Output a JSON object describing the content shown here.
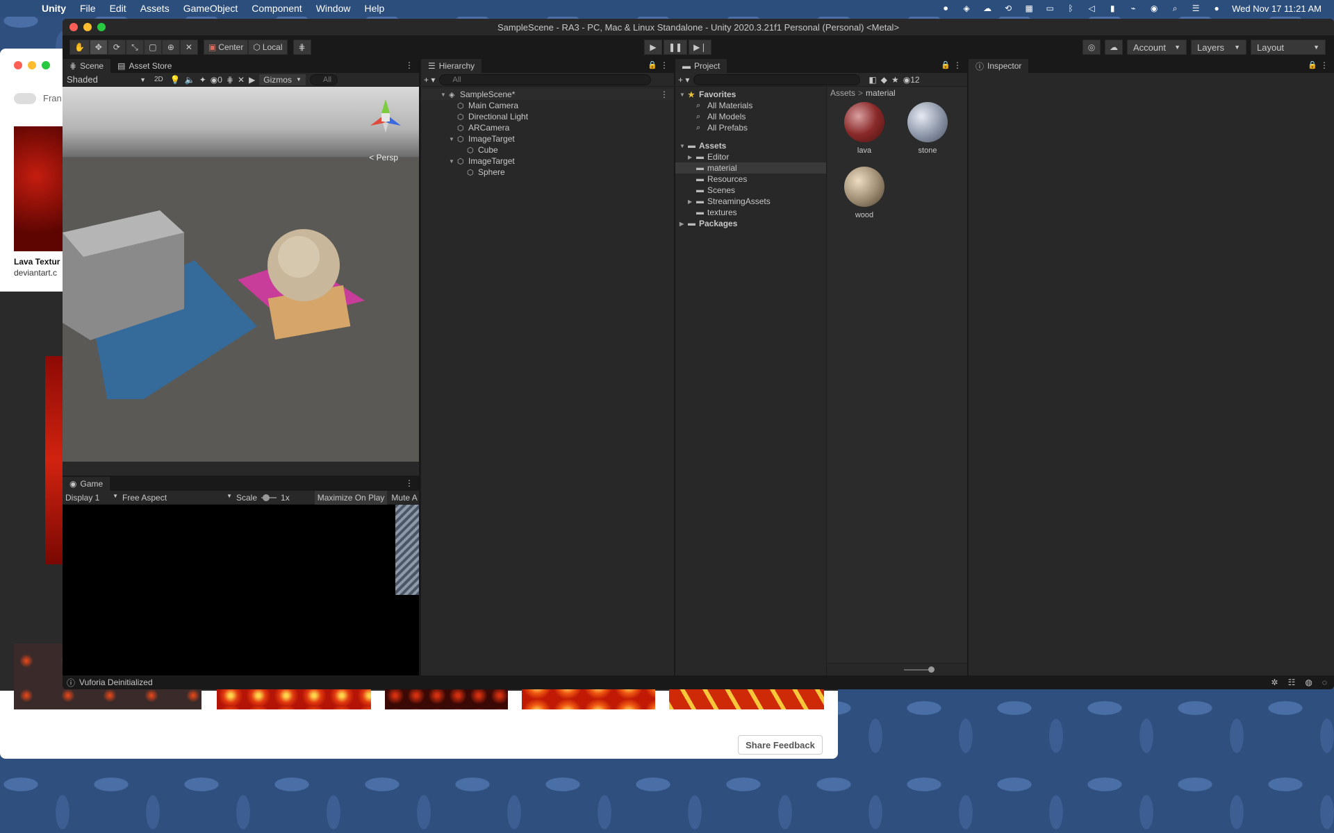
{
  "menubar": {
    "app": "Unity",
    "items": [
      "File",
      "Edit",
      "Assets",
      "GameObject",
      "Component",
      "Window",
      "Help"
    ],
    "clock": "Wed Nov 17  11:21 AM"
  },
  "browser": {
    "toggle_label": "Fran",
    "thumb_title": "Lava Textur",
    "thumb_source": "deviantart.c",
    "share_feedback": "Share Feedback"
  },
  "unity": {
    "title": "SampleScene - RA3 - PC, Mac & Linux Standalone - Unity 2020.3.21f1 Personal (Personal) <Metal>",
    "toolbar": {
      "center": "Center",
      "local": "Local",
      "account": "Account",
      "layers": "Layers",
      "layout": "Layout"
    },
    "scene_panel": {
      "tabs": [
        "Scene",
        "Asset Store"
      ],
      "shading": "Shaded",
      "mode_2d": "2D",
      "hidden_count": "0",
      "gizmos": "Gizmos",
      "search_placeholder": "All",
      "persp": "< Persp"
    },
    "game_panel": {
      "tab": "Game",
      "display": "Display 1",
      "aspect": "Free Aspect",
      "scale_label": "Scale",
      "scale_value": "1x",
      "maximize": "Maximize On Play",
      "mute": "Mute A"
    },
    "hierarchy": {
      "tab": "Hierarchy",
      "search_placeholder": "All",
      "scene": "SampleScene*",
      "items": [
        {
          "label": "Main Camera",
          "depth": 1
        },
        {
          "label": "Directional Light",
          "depth": 1
        },
        {
          "label": "ARCamera",
          "depth": 1
        },
        {
          "label": "ImageTarget",
          "depth": 1
        },
        {
          "label": "Cube",
          "depth": 2
        },
        {
          "label": "ImageTarget",
          "depth": 1
        },
        {
          "label": "Sphere",
          "depth": 2
        }
      ]
    },
    "project": {
      "tab": "Project",
      "hidden_count": "12",
      "favorites": "Favorites",
      "favorite_items": [
        "All Materials",
        "All Models",
        "All Prefabs"
      ],
      "assets": "Assets",
      "folders": [
        "Editor",
        "material",
        "Resources",
        "Scenes",
        "StreamingAssets",
        "textures"
      ],
      "packages": "Packages",
      "breadcrumb": [
        "Assets",
        "material"
      ],
      "materials": [
        "lava",
        "stone",
        "wood"
      ]
    },
    "inspector": {
      "tab": "Inspector"
    },
    "status": "Vuforia Deinitialized"
  }
}
